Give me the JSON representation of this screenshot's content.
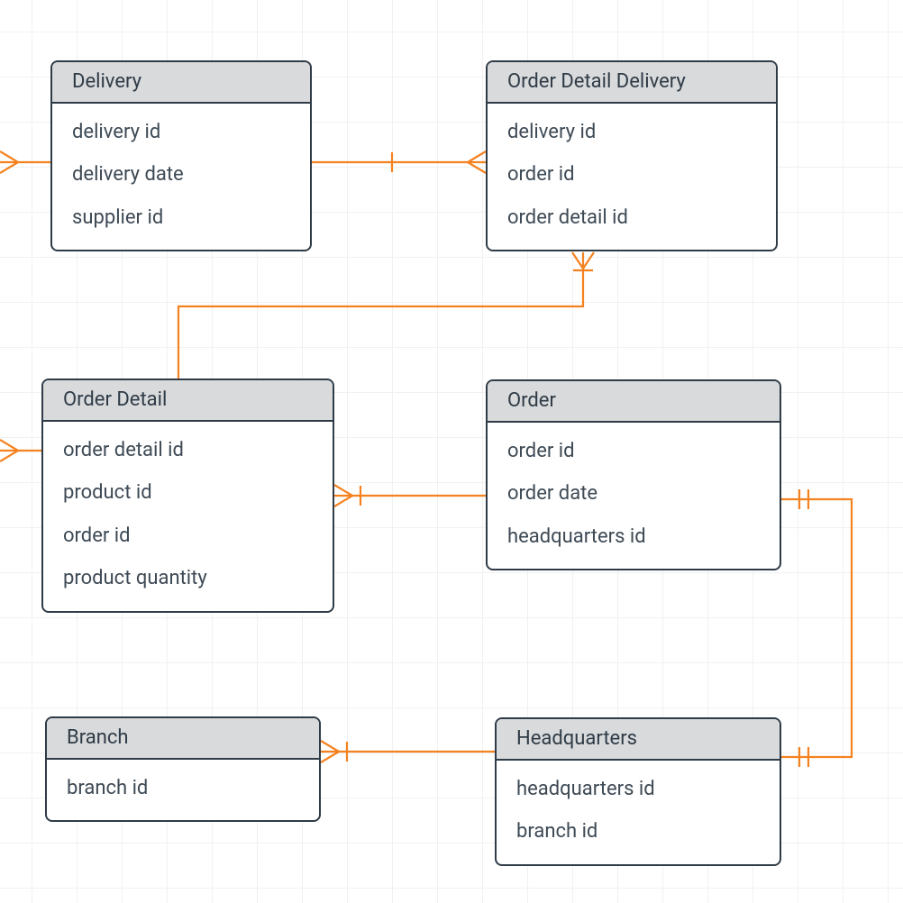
{
  "colors": {
    "entity_border": "#2f3b46",
    "entity_header_bg": "#d8dadc",
    "text": "#3e4a55",
    "connector": "#f58220",
    "grid": "#f0f1f2"
  },
  "entities": {
    "delivery": {
      "title": "Delivery",
      "attrs": [
        "delivery id",
        "delivery date",
        "supplier id"
      ]
    },
    "order_detail_delivery": {
      "title": "Order Detail Delivery",
      "attrs": [
        "delivery id",
        "order id",
        "order detail id"
      ]
    },
    "order_detail": {
      "title": "Order Detail",
      "attrs": [
        "order detail id",
        "product id",
        "order id",
        "product quantity"
      ]
    },
    "order": {
      "title": "Order",
      "attrs": [
        "order id",
        "order date",
        "headquarters id"
      ]
    },
    "branch": {
      "title": "Branch",
      "attrs": [
        "branch id"
      ]
    },
    "headquarters": {
      "title": "Headquarters",
      "attrs": [
        "headquarters id",
        "branch id"
      ]
    }
  },
  "relationships": [
    {
      "from": "delivery",
      "to": "off-left",
      "type": "crows-foot"
    },
    {
      "from": "delivery",
      "to": "order_detail_delivery",
      "type": "one-to-many"
    },
    {
      "from": "order_detail_delivery",
      "to": "order_detail",
      "type": "one-to-many"
    },
    {
      "from": "order_detail",
      "to": "off-left",
      "type": "crows-foot"
    },
    {
      "from": "order_detail",
      "to": "order",
      "type": "many-to-one"
    },
    {
      "from": "order",
      "to": "headquarters",
      "type": "one-to-one"
    },
    {
      "from": "branch",
      "to": "headquarters",
      "type": "many-to-one"
    }
  ]
}
